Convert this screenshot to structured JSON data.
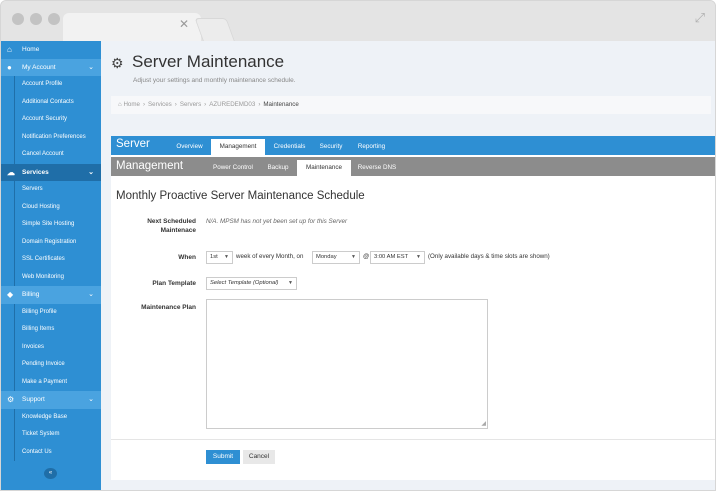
{
  "sidebar": {
    "home": "Home",
    "my_account": "My Account",
    "account_items": [
      "Account Profile",
      "Additional Contacts",
      "Account Security",
      "Notification Preferences",
      "Cancel Account"
    ],
    "services": "Services",
    "service_items": [
      "Servers",
      "Cloud Hosting",
      "Simple Site Hosting",
      "Domain Registration",
      "SSL Certificates",
      "Web Monitoring"
    ],
    "billing": "Billing",
    "billing_items": [
      "Billing Profile",
      "Billing Items",
      "Invoices",
      "Pending Invoice",
      "Make a Payment"
    ],
    "support": "Support",
    "support_items": [
      "Knowledge Base",
      "Ticket System",
      "Contact Us"
    ]
  },
  "page": {
    "title": "Server Maintenance",
    "subtitle": "Adjust your settings and monthly maintenance schedule."
  },
  "breadcrumb": [
    "Home",
    "Services",
    "Servers",
    "AZUREDEMD03",
    "Maintenance"
  ],
  "nav1": {
    "title": "Server",
    "tabs": [
      "Overview",
      "Management",
      "Credentials",
      "Security",
      "Reporting"
    ]
  },
  "nav2": {
    "title": "Management",
    "tabs": [
      "Power Control",
      "Backup",
      "Maintenance",
      "Reverse DNS"
    ]
  },
  "form": {
    "title": "Monthly Proactive Server Maintenance Schedule",
    "next_label_1": "Next Scheduled",
    "next_label_2": "Maintenace",
    "next_value": "N/A. MPSM has not yet been set up for this Server",
    "when_label": "When",
    "week_value": "1st",
    "week_text": "week of every Month, on",
    "day_value": "Monday",
    "at": "@",
    "time_value": "3:00 AM EST",
    "time_note": "(Only available days & time slots are shown)",
    "template_label": "Plan Template",
    "template_value": "Select Template (Optional)",
    "plan_label": "Maintenance Plan",
    "submit": "Submit",
    "cancel": "Cancel"
  },
  "colors": {
    "accent": "#2e8fd3",
    "subnav": "#8c8c8c"
  }
}
